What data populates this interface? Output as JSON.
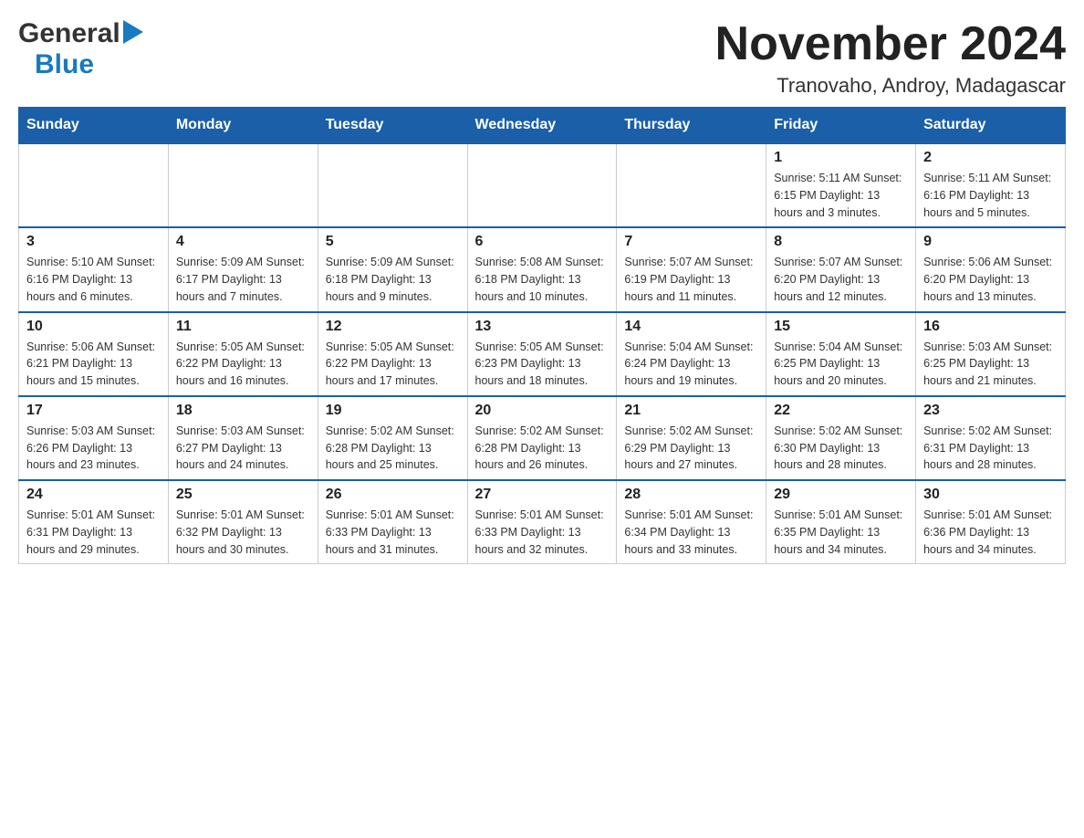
{
  "header": {
    "month_year": "November 2024",
    "location": "Tranovaho, Androy, Madagascar",
    "logo_general": "General",
    "logo_blue": "Blue"
  },
  "days_of_week": [
    "Sunday",
    "Monday",
    "Tuesday",
    "Wednesday",
    "Thursday",
    "Friday",
    "Saturday"
  ],
  "weeks": [
    {
      "days": [
        {
          "number": "",
          "info": ""
        },
        {
          "number": "",
          "info": ""
        },
        {
          "number": "",
          "info": ""
        },
        {
          "number": "",
          "info": ""
        },
        {
          "number": "",
          "info": ""
        },
        {
          "number": "1",
          "info": "Sunrise: 5:11 AM\nSunset: 6:15 PM\nDaylight: 13 hours and 3 minutes."
        },
        {
          "number": "2",
          "info": "Sunrise: 5:11 AM\nSunset: 6:16 PM\nDaylight: 13 hours and 5 minutes."
        }
      ]
    },
    {
      "days": [
        {
          "number": "3",
          "info": "Sunrise: 5:10 AM\nSunset: 6:16 PM\nDaylight: 13 hours and 6 minutes."
        },
        {
          "number": "4",
          "info": "Sunrise: 5:09 AM\nSunset: 6:17 PM\nDaylight: 13 hours and 7 minutes."
        },
        {
          "number": "5",
          "info": "Sunrise: 5:09 AM\nSunset: 6:18 PM\nDaylight: 13 hours and 9 minutes."
        },
        {
          "number": "6",
          "info": "Sunrise: 5:08 AM\nSunset: 6:18 PM\nDaylight: 13 hours and 10 minutes."
        },
        {
          "number": "7",
          "info": "Sunrise: 5:07 AM\nSunset: 6:19 PM\nDaylight: 13 hours and 11 minutes."
        },
        {
          "number": "8",
          "info": "Sunrise: 5:07 AM\nSunset: 6:20 PM\nDaylight: 13 hours and 12 minutes."
        },
        {
          "number": "9",
          "info": "Sunrise: 5:06 AM\nSunset: 6:20 PM\nDaylight: 13 hours and 13 minutes."
        }
      ]
    },
    {
      "days": [
        {
          "number": "10",
          "info": "Sunrise: 5:06 AM\nSunset: 6:21 PM\nDaylight: 13 hours and 15 minutes."
        },
        {
          "number": "11",
          "info": "Sunrise: 5:05 AM\nSunset: 6:22 PM\nDaylight: 13 hours and 16 minutes."
        },
        {
          "number": "12",
          "info": "Sunrise: 5:05 AM\nSunset: 6:22 PM\nDaylight: 13 hours and 17 minutes."
        },
        {
          "number": "13",
          "info": "Sunrise: 5:05 AM\nSunset: 6:23 PM\nDaylight: 13 hours and 18 minutes."
        },
        {
          "number": "14",
          "info": "Sunrise: 5:04 AM\nSunset: 6:24 PM\nDaylight: 13 hours and 19 minutes."
        },
        {
          "number": "15",
          "info": "Sunrise: 5:04 AM\nSunset: 6:25 PM\nDaylight: 13 hours and 20 minutes."
        },
        {
          "number": "16",
          "info": "Sunrise: 5:03 AM\nSunset: 6:25 PM\nDaylight: 13 hours and 21 minutes."
        }
      ]
    },
    {
      "days": [
        {
          "number": "17",
          "info": "Sunrise: 5:03 AM\nSunset: 6:26 PM\nDaylight: 13 hours and 23 minutes."
        },
        {
          "number": "18",
          "info": "Sunrise: 5:03 AM\nSunset: 6:27 PM\nDaylight: 13 hours and 24 minutes."
        },
        {
          "number": "19",
          "info": "Sunrise: 5:02 AM\nSunset: 6:28 PM\nDaylight: 13 hours and 25 minutes."
        },
        {
          "number": "20",
          "info": "Sunrise: 5:02 AM\nSunset: 6:28 PM\nDaylight: 13 hours and 26 minutes."
        },
        {
          "number": "21",
          "info": "Sunrise: 5:02 AM\nSunset: 6:29 PM\nDaylight: 13 hours and 27 minutes."
        },
        {
          "number": "22",
          "info": "Sunrise: 5:02 AM\nSunset: 6:30 PM\nDaylight: 13 hours and 28 minutes."
        },
        {
          "number": "23",
          "info": "Sunrise: 5:02 AM\nSunset: 6:31 PM\nDaylight: 13 hours and 28 minutes."
        }
      ]
    },
    {
      "days": [
        {
          "number": "24",
          "info": "Sunrise: 5:01 AM\nSunset: 6:31 PM\nDaylight: 13 hours and 29 minutes."
        },
        {
          "number": "25",
          "info": "Sunrise: 5:01 AM\nSunset: 6:32 PM\nDaylight: 13 hours and 30 minutes."
        },
        {
          "number": "26",
          "info": "Sunrise: 5:01 AM\nSunset: 6:33 PM\nDaylight: 13 hours and 31 minutes."
        },
        {
          "number": "27",
          "info": "Sunrise: 5:01 AM\nSunset: 6:33 PM\nDaylight: 13 hours and 32 minutes."
        },
        {
          "number": "28",
          "info": "Sunrise: 5:01 AM\nSunset: 6:34 PM\nDaylight: 13 hours and 33 minutes."
        },
        {
          "number": "29",
          "info": "Sunrise: 5:01 AM\nSunset: 6:35 PM\nDaylight: 13 hours and 34 minutes."
        },
        {
          "number": "30",
          "info": "Sunrise: 5:01 AM\nSunset: 6:36 PM\nDaylight: 13 hours and 34 minutes."
        }
      ]
    }
  ]
}
